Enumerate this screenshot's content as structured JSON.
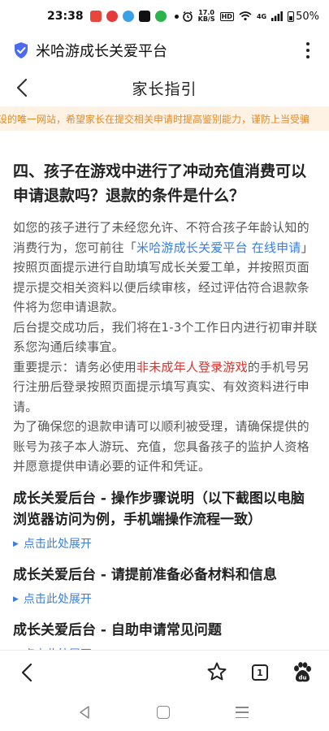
{
  "status_bar": {
    "time": "23:38",
    "net_speed_value": "17.0",
    "net_speed_unit": "KB/S",
    "hd": "HD",
    "signal": "4G",
    "battery": "50%"
  },
  "app_header": {
    "title": "米哈游成长关爱平台"
  },
  "page_nav": {
    "title": "家长指引"
  },
  "notice": {
    "text": "设的唯一网站，希望家长在提交相关申请时提高鉴别能力，谨防上当受骗"
  },
  "article": {
    "heading": "四、孩子在游戏中进行了冲动充值消费可以申请退款吗？退款的条件是什么？",
    "p1_before": "如您的孩子进行了未经您允许、不符合孩子年龄认知的消费行为，您可前往「",
    "p1_link": "米哈游成长关爱平台 在线申请",
    "p1_after": "」按照页面提示进行自助填写成长关爱工单，并按照页面提示提交相关资料以便后续审核，经过评估符合退款条件将为您申请退款。",
    "p2": "后台提交成功后，我们将在1-3个工作日内进行初审并联系您沟通后续事宜。",
    "p3_before": "重要提示：请务必使用",
    "p3_red": "非未成年人登录游戏",
    "p3_after": "的手机号另行注册后登录按照页面提示填写真实、有效资料进行申请。",
    "p4": "为了确保您的退款申请可以顺利被受理，请确保提供的账号为孩子本人游玩、充值，您具备孩子的监护人资格并愿意提供申请必要的证件和凭证。"
  },
  "sections": [
    {
      "title": "成长关爱后台 - 操作步骤说明（以下截图以电脑浏览器访问为例，手机端操作流程一致）",
      "expand_label": "点击此处展开"
    },
    {
      "title": "成长关爱后台 - 请提前准备必备材料和信息",
      "expand_label": "点击此处展开"
    },
    {
      "title": "成长关爱后台 - 自助申请常见问题",
      "expand_label": "点击此处展开"
    }
  ],
  "browser_bar": {
    "tab_count": "1"
  },
  "colors": {
    "link": "#3b7ee0",
    "warning_red": "#e0312b",
    "notice_bg": "#fdf2e4",
    "notice_text": "#e48a28",
    "shield": "#4a6cf0"
  }
}
